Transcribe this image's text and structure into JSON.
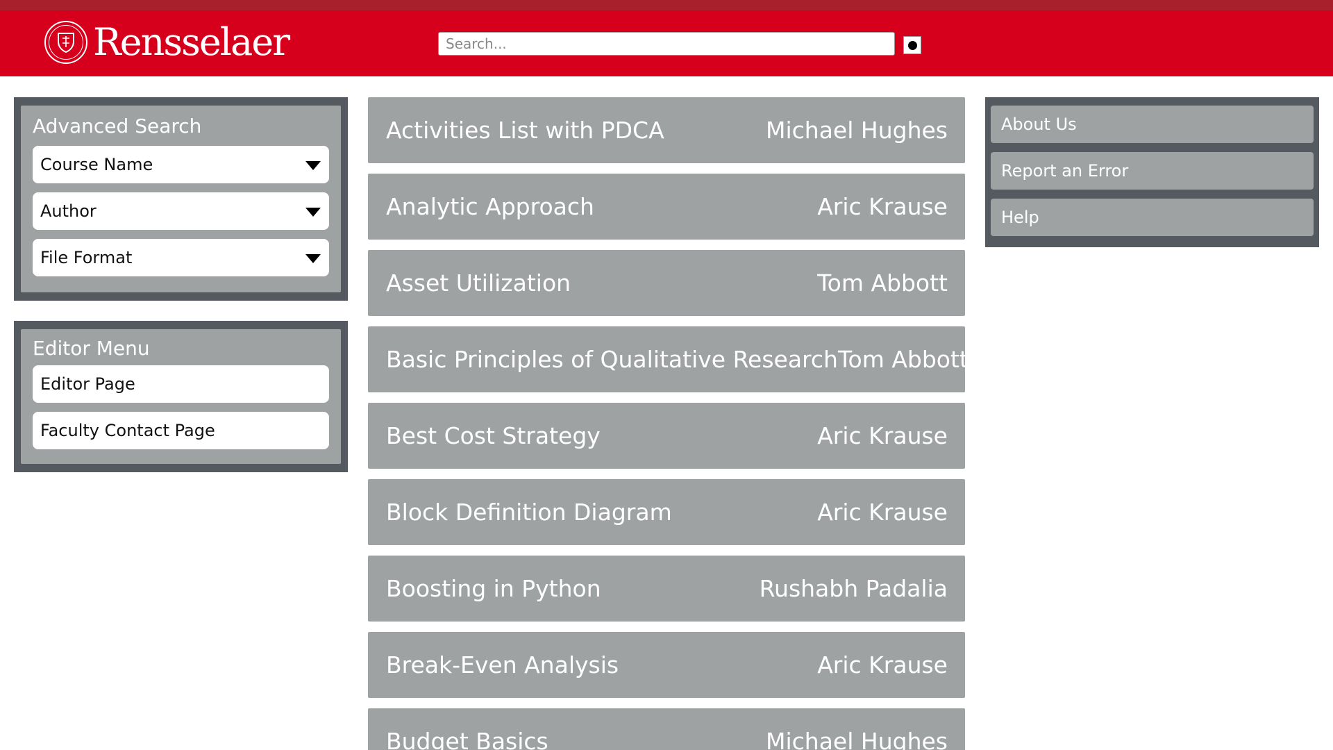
{
  "header": {
    "logo_text": "Rensselaer",
    "search_placeholder": "Search..."
  },
  "colors": {
    "brand_red": "#d6001c",
    "top_strip": "#a8202c",
    "panel_dark": "#545a5f",
    "panel_gray": "#9ea2a3"
  },
  "advanced_search": {
    "title": "Advanced Search",
    "filters": [
      {
        "label": "Course Name"
      },
      {
        "label": "Author"
      },
      {
        "label": "File Format"
      }
    ]
  },
  "editor_menu": {
    "title": "Editor Menu",
    "items": [
      {
        "label": "Editor Page"
      },
      {
        "label": "Faculty Contact Page"
      }
    ]
  },
  "courses": [
    {
      "name": "Activities List with PDCA",
      "author": "Michael Hughes"
    },
    {
      "name": "Analytic Approach",
      "author": "Aric Krause"
    },
    {
      "name": "Asset Utilization",
      "author": "Tom Abbott"
    },
    {
      "name": "Basic Principles of Qualitative Research",
      "author": "Tom Abbott"
    },
    {
      "name": "Best Cost Strategy",
      "author": "Aric Krause"
    },
    {
      "name": "Block Definition Diagram",
      "author": "Aric Krause"
    },
    {
      "name": "Boosting in Python",
      "author": "Rushabh Padalia"
    },
    {
      "name": "Break-Even Analysis",
      "author": "Aric Krause"
    },
    {
      "name": "Budget Basics",
      "author": "Michael Hughes"
    }
  ],
  "right_nav": {
    "items": [
      {
        "label": "About Us"
      },
      {
        "label": "Report an Error"
      },
      {
        "label": "Help"
      }
    ]
  }
}
